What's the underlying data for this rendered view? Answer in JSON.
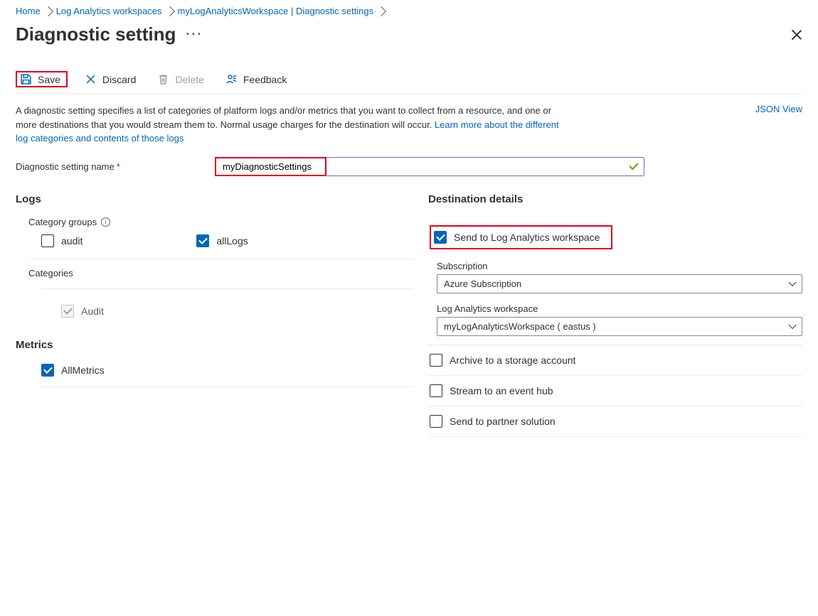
{
  "breadcrumb": {
    "items": [
      "Home",
      "Log Analytics workspaces",
      "myLogAnalyticsWorkspace | Diagnostic settings"
    ]
  },
  "title": "Diagnostic setting",
  "toolbar": {
    "save": "Save",
    "discard": "Discard",
    "delete": "Delete",
    "feedback": "Feedback"
  },
  "description": {
    "text": "A diagnostic setting specifies a list of categories of platform logs and/or metrics that you want to collect from a resource, and one or more destinations that you would stream them to. Normal usage charges for the destination will occur. ",
    "link": "Learn more about the different log categories and contents of those logs"
  },
  "json_view": "JSON View",
  "name_field": {
    "label": "Diagnostic setting name",
    "value": "myDiagnosticSettings"
  },
  "logs": {
    "header": "Logs",
    "category_groups_label": "Category groups",
    "groups": [
      {
        "label": "audit",
        "checked": false
      },
      {
        "label": "allLogs",
        "checked": true
      }
    ],
    "categories_label": "Categories",
    "categories": [
      {
        "label": "Audit",
        "checked": true,
        "disabled": true
      }
    ]
  },
  "metrics": {
    "header": "Metrics",
    "items": [
      {
        "label": "AllMetrics",
        "checked": true
      }
    ]
  },
  "destinations": {
    "header": "Destination details",
    "items": [
      {
        "label": "Send to Log Analytics workspace",
        "checked": true,
        "highlighted": true,
        "fields": {
          "subscription_label": "Subscription",
          "subscription_value": "Azure Subscription",
          "workspace_label": "Log Analytics workspace",
          "workspace_value": "myLogAnalyticsWorkspace ( eastus )"
        }
      },
      {
        "label": "Archive to a storage account",
        "checked": false
      },
      {
        "label": "Stream to an event hub",
        "checked": false
      },
      {
        "label": "Send to partner solution",
        "checked": false
      }
    ]
  }
}
